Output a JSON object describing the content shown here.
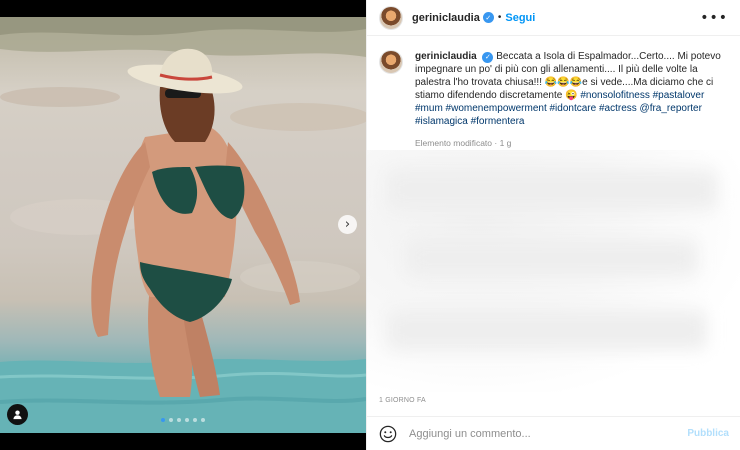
{
  "post": {
    "username": "gerinicla udia",
    "verified_icon": "verified-badge-icon",
    "separator": "•",
    "follow_label": "Segui",
    "more_label": "•••"
  },
  "caption": {
    "username": "gerinicla udia",
    "text": "Beccata a Isola di Espalmador...Certo.... Mi potevo impegnare un po' di più con gli allenamenti.... Il più delle volte la palestra l'ho trovata chiusa!!! 😂😂😂e si vede....Ma diciamo che ci stiamo difendendo discretamente 😜",
    "hashtags": "#nonsolofitness #pastalover #mum #womenempowerment #idontcare #actress @fra_reporter #islamagica #formentera",
    "meta": "Elemento modificato · 1 g"
  },
  "media": {
    "next_icon": "chevron-right-icon",
    "next_label": "›",
    "tag_icon": "user-tag-icon",
    "carousel_count": 6,
    "carousel_active": 1
  },
  "footer": {
    "time_ago": "1 GIORNO FA",
    "emoji_icon": "smiley-icon",
    "comment_placeholder": "Aggiungi un commento...",
    "publish_label": "Pubblica"
  },
  "colors": {
    "link_blue": "#0095f6",
    "tag_blue": "#00376b",
    "publish_disabled": "#b2dffc",
    "verified_blue": "#3897f0"
  }
}
